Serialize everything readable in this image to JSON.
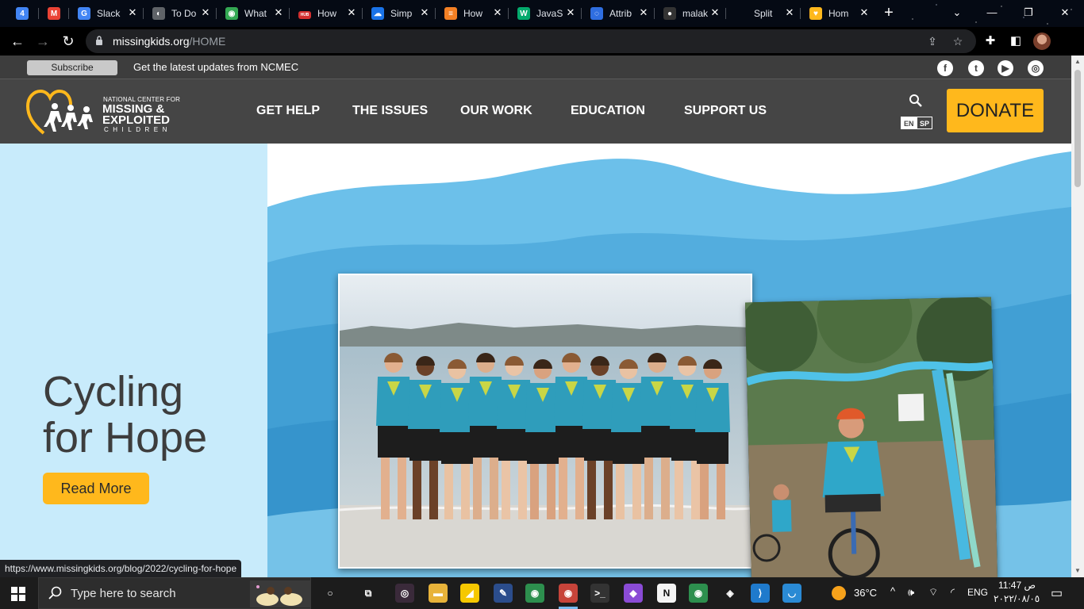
{
  "browser": {
    "tabs": [
      {
        "title": "",
        "favicon": "calendar-icon",
        "fav_text": "4",
        "fav_color": "#4285f4"
      },
      {
        "title": "",
        "favicon": "gmail-icon",
        "fav_text": "M",
        "fav_color": "#ea4335"
      },
      {
        "title": "Slack",
        "favicon": "google-icon",
        "fav_text": "G",
        "fav_color": "#4285f4"
      },
      {
        "title": "To Do",
        "favicon": "globe-icon",
        "fav_text": "◐",
        "fav_color": "#5f6368"
      },
      {
        "title": "What",
        "favicon": "chrome-icon",
        "fav_text": "◉",
        "fav_color": "#34a853"
      },
      {
        "title": "How",
        "favicon": "hubspot-icon",
        "fav_text": "HUB",
        "fav_color": "#d32f2f"
      },
      {
        "title": "Simp",
        "favicon": "cloud-icon",
        "fav_text": "☁",
        "fav_color": "#1a73e8"
      },
      {
        "title": "How",
        "favicon": "stackoverflow-icon",
        "fav_text": "≡",
        "fav_color": "#f48024"
      },
      {
        "title": "JavaS",
        "favicon": "w3schools-icon",
        "fav_text": "W",
        "fav_color": "#04aa6d"
      },
      {
        "title": "Attrib",
        "favicon": "webpack-icon",
        "fav_text": "◌",
        "fav_color": "#2f6ee0"
      },
      {
        "title": "malak",
        "favicon": "github-icon",
        "fav_text": "●",
        "fav_color": "#333333"
      },
      {
        "title": "Split",
        "favicon": "blank-icon",
        "fav_text": "",
        "fav_color": "transparent"
      },
      {
        "title": "Hom",
        "favicon": "ncmec-icon",
        "fav_text": "♥",
        "fav_color": "#ffb81c"
      }
    ],
    "url_host": "missingkids.org",
    "url_path": "/HOME",
    "status_url": "https://www.missingkids.org/blog/2022/cycling-for-hope"
  },
  "site": {
    "topbar": {
      "subscribe_label": "Subscribe",
      "tagline": "Get the latest updates from NCMEC",
      "social": [
        "facebook-icon",
        "twitter-icon",
        "youtube-icon",
        "instagram-icon"
      ]
    },
    "logo": {
      "line1": "NATIONAL CENTER FOR",
      "line2": "MISSING &",
      "line3": "EXPLOITED",
      "line4": "CHILDREN"
    },
    "nav": [
      "GET HELP",
      "THE ISSUES",
      "OUR WORK",
      "EDUCATION",
      "SUPPORT US"
    ],
    "lang_en": "EN",
    "lang_sp": "SP",
    "donate_label": "DONATE",
    "hero": {
      "title_line1": "Cycling",
      "title_line2": "for Hope",
      "read_more_label": "Read More"
    },
    "colors": {
      "accent": "#ffb81c",
      "dark": "#454545",
      "hero_bg": "#c8ebfb",
      "water": "#5fb6e3"
    }
  },
  "taskbar": {
    "search_placeholder": "Type here to search",
    "weather": "36°C",
    "lang": "ENG",
    "time": "11:47 ص",
    "date": "٢٠٢٢/٠٨/٠٥",
    "apps": [
      "cortana-icon",
      "task-view-icon",
      "media-icon",
      "file-explorer-icon",
      "sticky-notes-icon",
      "paint-icon",
      "chrome-icon",
      "chrome-profile-icon",
      "terminal-icon",
      "drop-icon",
      "notion-icon",
      "chrome-canary-icon",
      "figma-icon",
      "vscode-icon",
      "edge-icon"
    ]
  }
}
